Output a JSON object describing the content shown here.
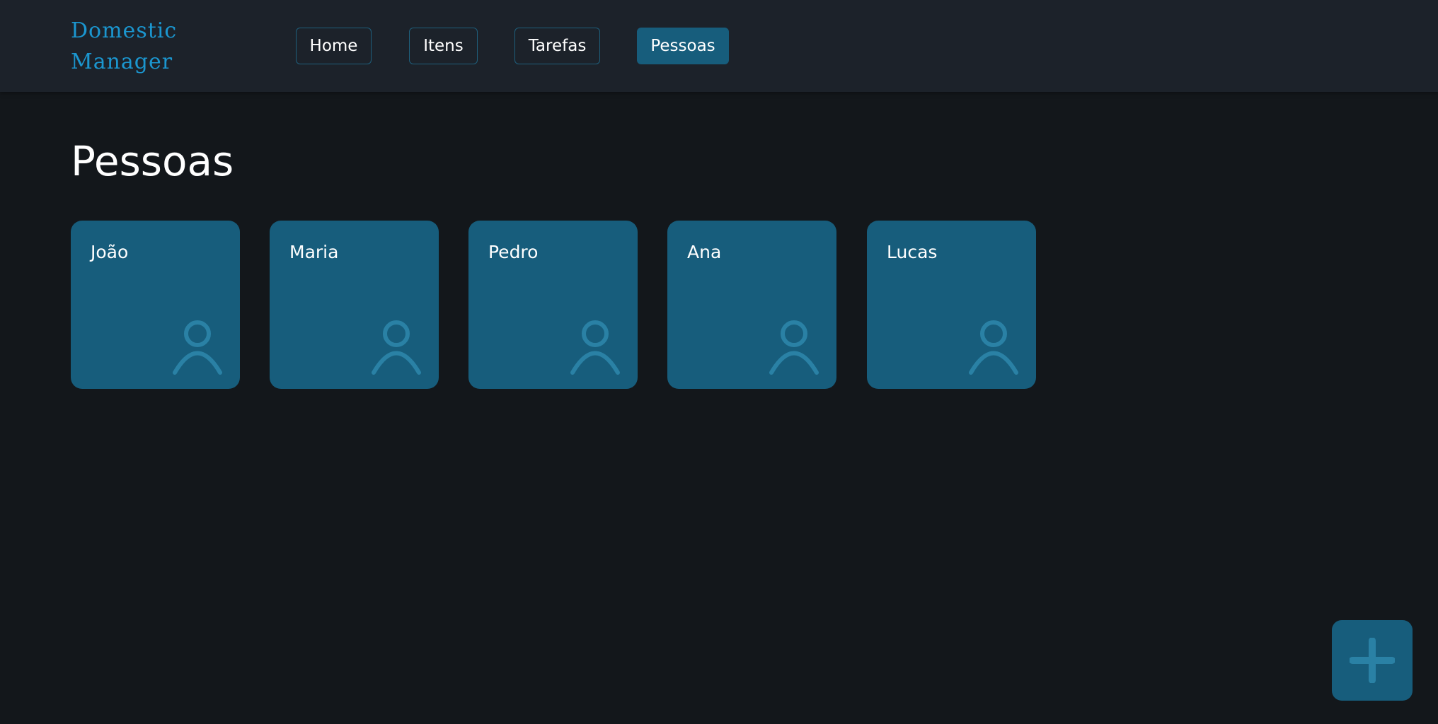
{
  "app": {
    "logo_line1": "Domestic",
    "logo_line2": "Manager"
  },
  "nav": {
    "items": [
      {
        "label": "Home",
        "active": false
      },
      {
        "label": "Itens",
        "active": false
      },
      {
        "label": "Tarefas",
        "active": false
      },
      {
        "label": "Pessoas",
        "active": true
      }
    ]
  },
  "main": {
    "title": "Pessoas",
    "people": [
      {
        "name": "João",
        "icon": "person-icon"
      },
      {
        "name": "Maria",
        "icon": "person-icon"
      },
      {
        "name": "Pedro",
        "icon": "person-icon"
      },
      {
        "name": "Ana",
        "icon": "person-icon"
      },
      {
        "name": "Lucas",
        "icon": "person-icon"
      }
    ]
  },
  "fab": {
    "icon": "plus-icon"
  },
  "colors": {
    "background": "#13171b",
    "header": "#1c222a",
    "accent": "#175d7c",
    "logo": "#1b96cf",
    "icon_tint": "#2a81a5"
  }
}
